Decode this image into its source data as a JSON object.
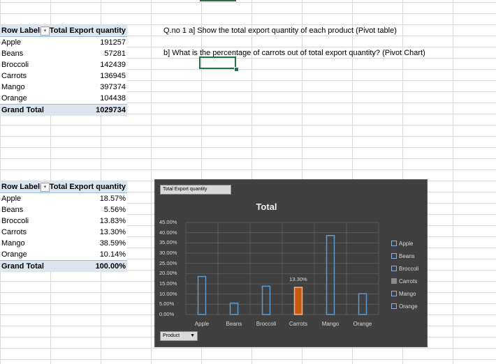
{
  "pivot1": {
    "row_labels_header": "Row Labels",
    "value_header": "Total Export quantity",
    "rows": [
      {
        "label": "Apple",
        "value": "191257"
      },
      {
        "label": "Beans",
        "value": "57281"
      },
      {
        "label": "Broccoli",
        "value": "142439"
      },
      {
        "label": "Carrots",
        "value": "136945"
      },
      {
        "label": "Mango",
        "value": "397374"
      },
      {
        "label": "Orange",
        "value": "104438"
      }
    ],
    "grand_total_label": "Grand Total",
    "grand_total_value": "1029734"
  },
  "pivot2": {
    "row_labels_header": "Row Labels",
    "value_header": "Total Export quantity",
    "rows": [
      {
        "label": "Apple",
        "value": "18.57%"
      },
      {
        "label": "Beans",
        "value": "5.56%"
      },
      {
        "label": "Broccoli",
        "value": "13.83%"
      },
      {
        "label": "Carrots",
        "value": "13.30%"
      },
      {
        "label": "Mango",
        "value": "38.59%"
      },
      {
        "label": "Orange",
        "value": "10.14%"
      }
    ],
    "grand_total_label": "Grand Total",
    "grand_total_value": "100.00%"
  },
  "questions": {
    "q1": "Q.no 1  a] Show the total export quantity of each product (Pivot table)",
    "q2": "b] What is the percentage of carrots out of total export quantity? (Pivot Chart)"
  },
  "chart": {
    "value_field_button": "Total Export quantity",
    "axis_field_button": "Product",
    "colors": {
      "background": "#404040",
      "outline": "#5b9bd5",
      "highlight": "#c55a11",
      "text": "#d9d9d9"
    }
  },
  "chart_data": {
    "type": "bar",
    "title": "Total",
    "categories": [
      "Apple",
      "Beans",
      "Broccoli",
      "Carrots",
      "Mango",
      "Orange"
    ],
    "values": [
      18.57,
      5.56,
      13.83,
      13.3,
      38.59,
      10.14
    ],
    "highlighted_category": "Carrots",
    "data_label": "13.30%",
    "ylim": [
      0,
      45
    ],
    "yticks": [
      "0.00%",
      "5.00%",
      "10.00%",
      "15.00%",
      "20.00%",
      "25.00%",
      "30.00%",
      "35.00%",
      "40.00%",
      "45.00%"
    ],
    "legend": [
      "Apple",
      "Beans",
      "Broccoli",
      "Carrots",
      "Mango",
      "Orange"
    ],
    "legend_position": "right",
    "grid": true
  }
}
